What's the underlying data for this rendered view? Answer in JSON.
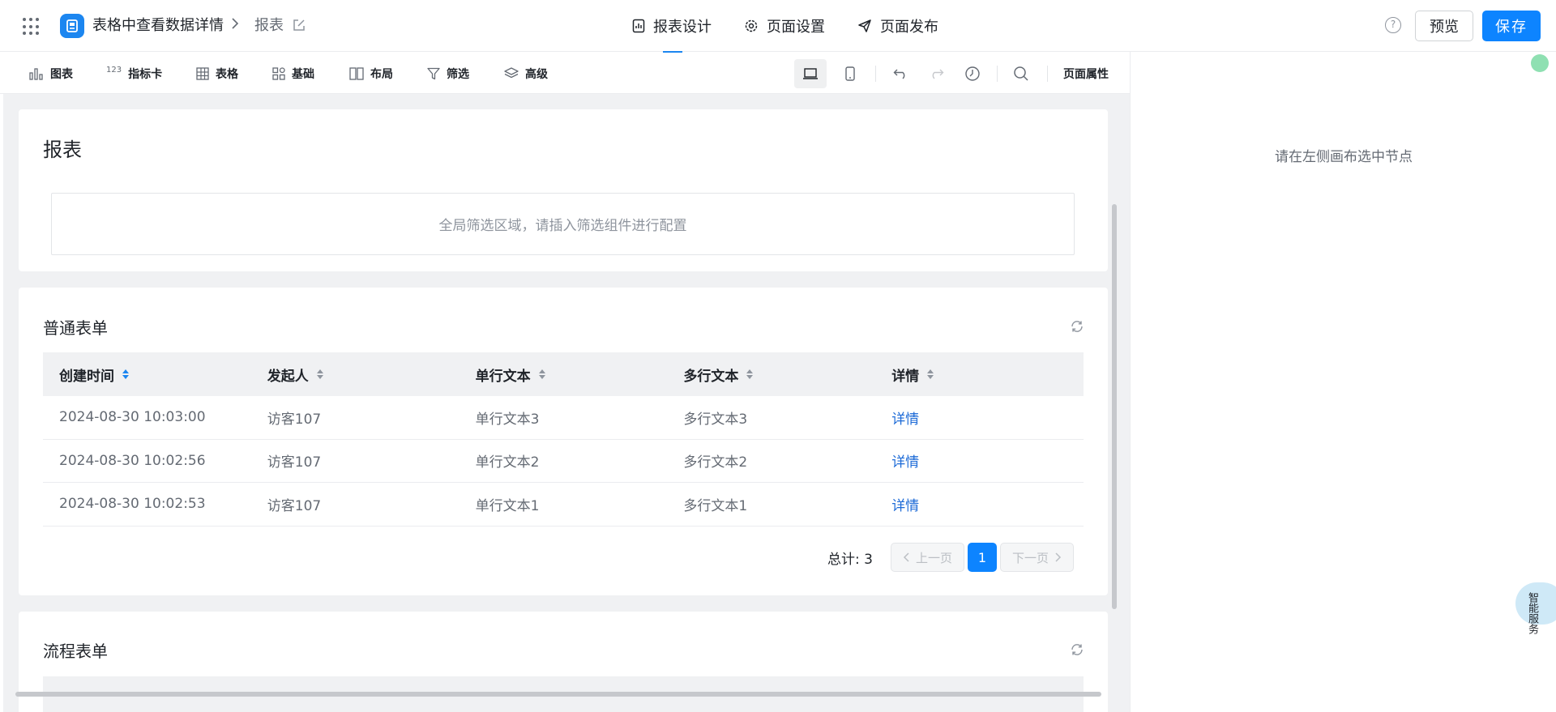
{
  "header": {
    "app_name": "表格中查看数据详情",
    "breadcrumb_sep": ">",
    "page_name": "报表",
    "tabs": [
      {
        "label": "报表设计",
        "icon": "report-design-icon",
        "active": true
      },
      {
        "label": "页面设置",
        "icon": "gear-icon",
        "active": false
      },
      {
        "label": "页面发布",
        "icon": "send-icon",
        "active": false
      }
    ],
    "help": "?",
    "preview_label": "预览",
    "save_label": "保存"
  },
  "toolbar": {
    "items": [
      {
        "label": "图表",
        "icon": "bar-chart-icon"
      },
      {
        "label": "指标卡",
        "icon": "metric-card-icon"
      },
      {
        "label": "表格",
        "icon": "table-icon"
      },
      {
        "label": "基础",
        "icon": "basic-grid-icon"
      },
      {
        "label": "布局",
        "icon": "layout-icon"
      },
      {
        "label": "筛选",
        "icon": "filter-icon"
      },
      {
        "label": "高级",
        "icon": "layers-icon"
      }
    ],
    "metric_prefix": "123",
    "page_props_label": "页面属性"
  },
  "canvas": {
    "report_title": "报表",
    "filter_placeholder": "全局筛选区域，请插入筛选组件进行配置",
    "normal_form": {
      "title": "普通表单",
      "columns": [
        "创建时间",
        "发起人",
        "单行文本",
        "多行文本",
        "详情"
      ],
      "rows": [
        [
          "2024-08-30 10:03:00",
          "访客107",
          "单行文本3",
          "多行文本3",
          "详情"
        ],
        [
          "2024-08-30 10:02:56",
          "访客107",
          "单行文本2",
          "多行文本2",
          "详情"
        ],
        [
          "2024-08-30 10:02:53",
          "访客107",
          "单行文本1",
          "多行文本1",
          "详情"
        ]
      ],
      "pager": {
        "total": "总计: 3",
        "prev": "上一页",
        "current": "1",
        "next": "下一页"
      }
    },
    "flow_form": {
      "title": "流程表单"
    }
  },
  "right_panel": {
    "hint": "请在左侧画布选中节点"
  },
  "assistant": {
    "label": "智能服务"
  },
  "colors": {
    "primary": "#0d84ff",
    "link": "#1c6ad7",
    "status_dot": "#8fe0b2"
  }
}
